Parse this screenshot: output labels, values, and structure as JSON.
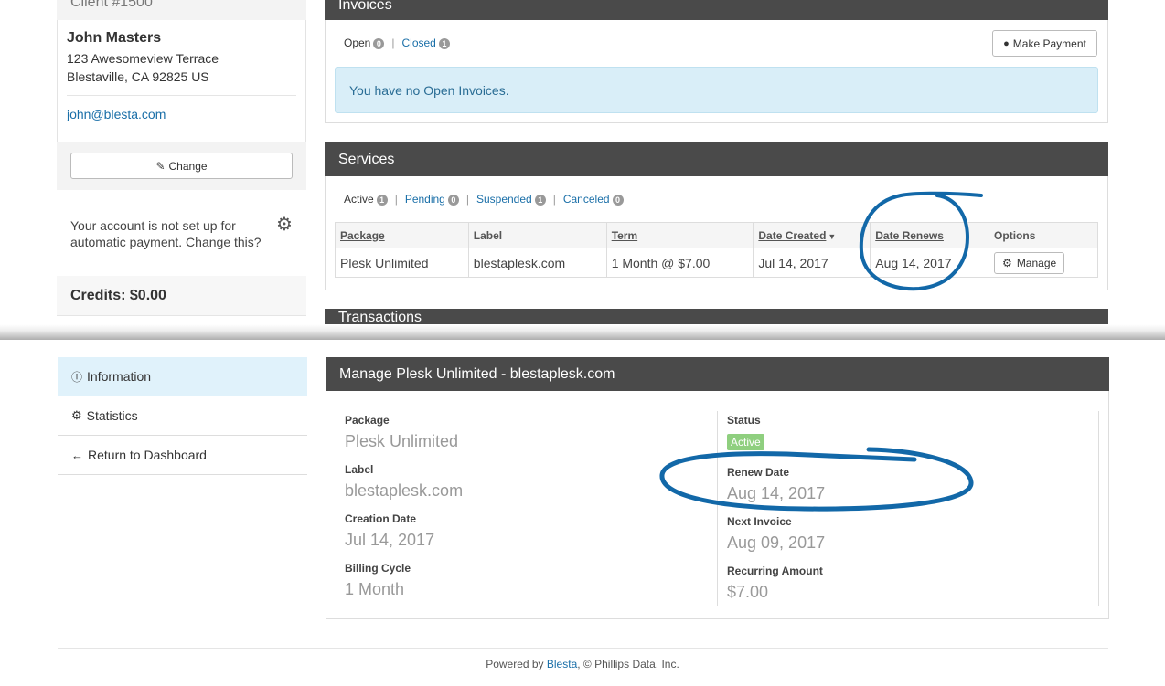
{
  "client": {
    "header": "Client #1500",
    "name": "John Masters",
    "address_line1": "123 Awesomeview Terrace",
    "address_line2": "Blestaville, CA 92825 US",
    "email": "john@blesta.com",
    "change_label": "Change",
    "autopay_text": "Your account is not set up for automatic payment. Change this?",
    "credits": "Credits: $0.00"
  },
  "invoices": {
    "title": "Invoices",
    "tabs": [
      {
        "label": "Open",
        "count": "0"
      },
      {
        "label": "Closed",
        "count": "1"
      }
    ],
    "make_payment": "Make Payment",
    "alert": "You have no Open Invoices."
  },
  "services": {
    "title": "Services",
    "tabs": [
      {
        "label": "Active",
        "count": "1"
      },
      {
        "label": "Pending",
        "count": "0"
      },
      {
        "label": "Suspended",
        "count": "1"
      },
      {
        "label": "Canceled",
        "count": "0"
      }
    ],
    "columns": [
      "Package",
      "Label",
      "Term",
      "Date Created",
      "Date Renews",
      "Options"
    ],
    "rows": [
      {
        "package": "Plesk Unlimited",
        "label": "blestaplesk.com",
        "term": "1 Month @ $7.00",
        "created": "Jul 14, 2017",
        "renews": "Aug 14, 2017",
        "manage": "Manage"
      }
    ]
  },
  "transactions": {
    "title": "Transactions"
  },
  "nav": {
    "items": [
      {
        "label": "Information",
        "icon": "info-icon"
      },
      {
        "label": "Statistics",
        "icon": "gear-icon"
      },
      {
        "label": "Return to Dashboard",
        "icon": "arrow-left-icon"
      }
    ]
  },
  "manage": {
    "title": "Manage Plesk Unlimited - blestaplesk.com",
    "left": [
      {
        "label": "Package",
        "value": "Plesk Unlimited"
      },
      {
        "label": "Label",
        "value": "blestaplesk.com"
      },
      {
        "label": "Creation Date",
        "value": "Jul 14, 2017"
      },
      {
        "label": "Billing Cycle",
        "value": "1 Month"
      }
    ],
    "status_label": "Status",
    "status_value": "Active",
    "right": [
      {
        "label": "Renew Date",
        "value": "Aug 14, 2017"
      },
      {
        "label": "Next Invoice",
        "value": "Aug 09, 2017"
      },
      {
        "label": "Recurring Amount",
        "value": "$7.00"
      }
    ]
  },
  "footer": {
    "prefix": "Powered by ",
    "link": "Blesta",
    "suffix": ", © Phillips Data, Inc."
  },
  "colors": {
    "panel_header": "#4a4a4a",
    "link": "#1a6fa8",
    "annotation_ink": "#1268a8",
    "active_badge": "#8fcf7f",
    "nav_active": "#e0f2fb"
  }
}
